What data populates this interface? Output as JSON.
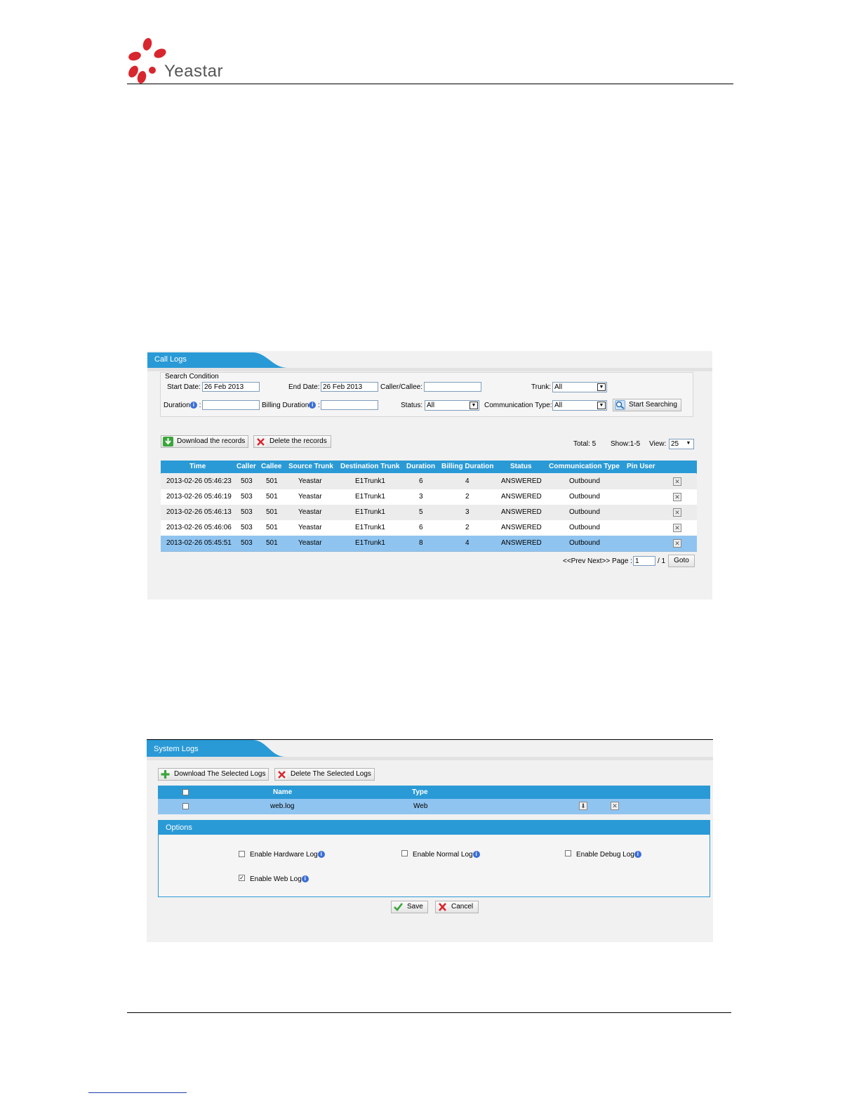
{
  "header": {
    "brand": "Yeastar"
  },
  "call_logs": {
    "tab_title": "Call Logs",
    "search": {
      "legend": "Search Condition",
      "start_date_label": "Start Date:",
      "start_date_value": "26 Feb 2013",
      "end_date_label": "End Date:",
      "end_date_value": "26 Feb 2013",
      "caller_callee_label": "Caller/Callee:",
      "caller_callee_value": "",
      "trunk_label": "Trunk:",
      "trunk_value": "All",
      "duration_label": "Duration",
      "billing_duration_label": "Billing Duration",
      "status_label": "Status:",
      "status_value": "All",
      "comm_type_label": "Communication Type:",
      "comm_type_value": "All",
      "search_button": "Start Searching"
    },
    "actions": {
      "download": "Download the records",
      "delete": "Delete the records"
    },
    "summary": {
      "total": "Total: 5",
      "show": "Show:1-5",
      "view_label": "View:",
      "view_value": "25"
    },
    "columns": [
      "Time",
      "Caller",
      "Callee",
      "Source Trunk",
      "Destination Trunk",
      "Duration",
      "Billing Duration",
      "Status",
      "Communication Type",
      "Pin User"
    ],
    "rows": [
      {
        "time": "2013-02-26 05:46:23",
        "caller": "503",
        "callee": "501",
        "source": "Yeastar",
        "dest": "E1Trunk1",
        "duration": "6",
        "billing": "4",
        "status": "ANSWERED",
        "comm": "Outbound",
        "pin": ""
      },
      {
        "time": "2013-02-26 05:46:19",
        "caller": "503",
        "callee": "501",
        "source": "Yeastar",
        "dest": "E1Trunk1",
        "duration": "3",
        "billing": "2",
        "status": "ANSWERED",
        "comm": "Outbound",
        "pin": ""
      },
      {
        "time": "2013-02-26 05:46:13",
        "caller": "503",
        "callee": "501",
        "source": "Yeastar",
        "dest": "E1Trunk1",
        "duration": "5",
        "billing": "3",
        "status": "ANSWERED",
        "comm": "Outbound",
        "pin": ""
      },
      {
        "time": "2013-02-26 05:46:06",
        "caller": "503",
        "callee": "501",
        "source": "Yeastar",
        "dest": "E1Trunk1",
        "duration": "6",
        "billing": "2",
        "status": "ANSWERED",
        "comm": "Outbound",
        "pin": ""
      },
      {
        "time": "2013-02-26 05:45:51",
        "caller": "503",
        "callee": "501",
        "source": "Yeastar",
        "dest": "E1Trunk1",
        "duration": "8",
        "billing": "4",
        "status": "ANSWERED",
        "comm": "Outbound",
        "pin": ""
      }
    ],
    "pager": {
      "prev_next": "<<Prev Next>> Page :",
      "page_value": "1",
      "of": "/ 1",
      "goto": "Goto"
    }
  },
  "system_logs": {
    "tab_title": "System Logs",
    "actions": {
      "download": "Download The Selected Logs",
      "delete": "Delete The Selected Logs"
    },
    "columns": [
      "Name",
      "Type"
    ],
    "rows": [
      {
        "name": "web.log",
        "type": "Web"
      }
    ],
    "options": {
      "title": "Options",
      "hardware": "Enable Hardware Log",
      "normal": "Enable Normal Log",
      "debug": "Enable Debug Log",
      "web": "Enable Web Log",
      "web_checked": true
    },
    "save": "Save",
    "cancel": "Cancel"
  },
  "colors": {
    "accent_blue": "#2a9ad6",
    "selected_row": "#8fc4f0",
    "logo_red": "#d8262e"
  },
  "icons": [
    "logo-icon",
    "info-icon",
    "download-icon",
    "delete-icon",
    "search-icon",
    "remove-icon",
    "add-icon",
    "save-icon",
    "cancel-icon"
  ]
}
